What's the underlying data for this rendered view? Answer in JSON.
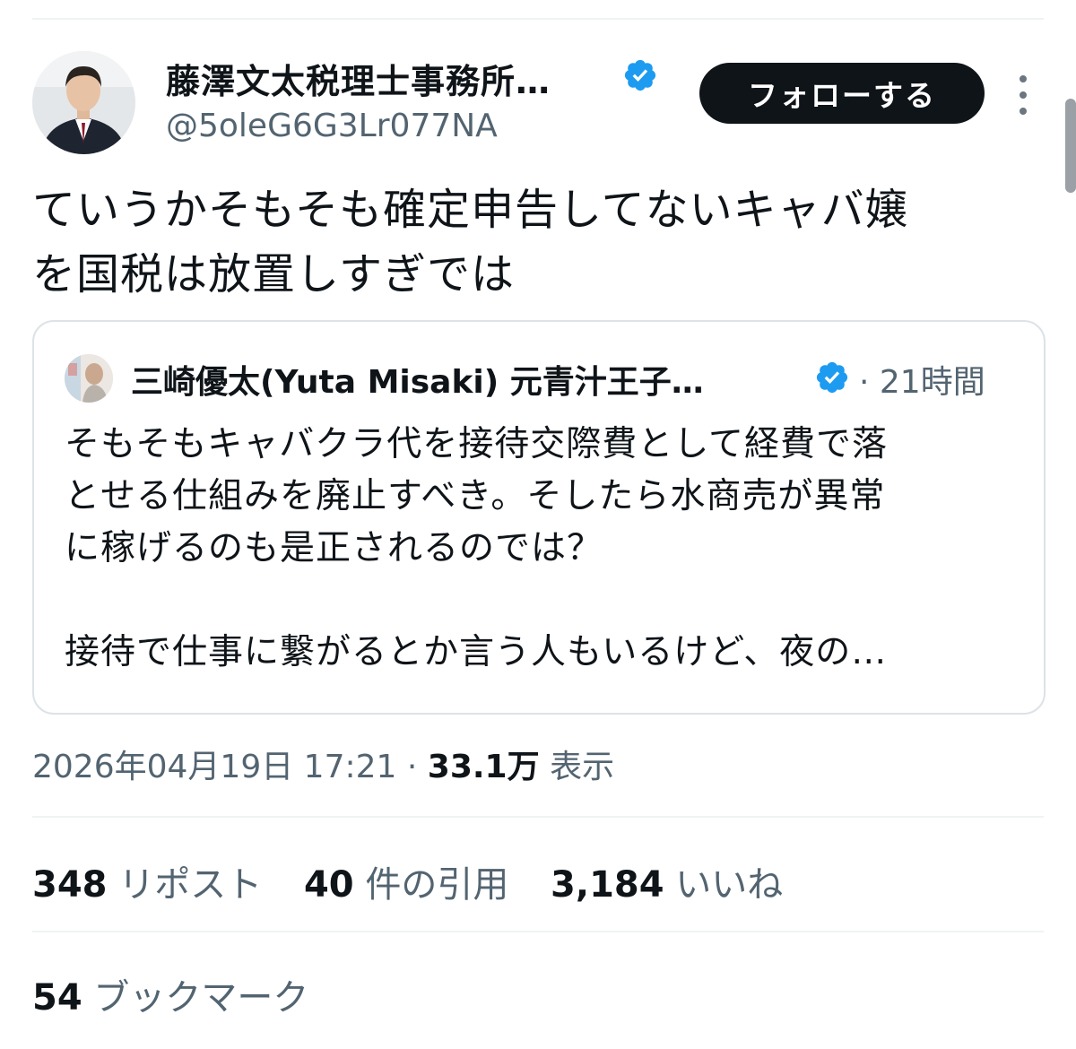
{
  "tweet": {
    "author": {
      "name": "藤澤文太税理士事務所…",
      "handle": "@5oleG6G3Lr077NA",
      "verified": true
    },
    "follow_label": "フォローする",
    "text_lines": [
      "ていうかそもそも確定申告してないキャバ嬢",
      "を国税は放置しすぎでは"
    ],
    "quote": {
      "author": "三崎優太(Yuta Misaki) 元青汁王子…",
      "verified": true,
      "time": "· 21時間",
      "lines": [
        "そもそもキャバクラ代を接待交際費として経費で落",
        "とせる仕組みを廃止すべき。そしたら水商売が異常",
        "に稼げるのも是正されるのでは？",
        "接待で仕事に繋がるとか言う人もいるけど、夜の…"
      ]
    },
    "meta": {
      "timestamp": "2026年04月19日 17:21",
      "separator": " · ",
      "views_count": "33.1万",
      "views_label": "表示"
    },
    "stats": {
      "reposts_count": "348",
      "reposts_label": "リポスト",
      "quotes_count": "40",
      "quotes_label": "件の引用",
      "likes_count": "3,184",
      "likes_label": "いいね",
      "bookmarks_count": "54",
      "bookmarks_label": "ブックマーク"
    }
  },
  "colors": {
    "text_primary": "#0f1419",
    "text_secondary": "#536471",
    "verified_blue": "#1d9bf0",
    "button_bg": "#0f1419",
    "border": "#dce3e7"
  },
  "icons": {
    "verified": "verified-badge-icon",
    "more": "more-vertical-icon"
  }
}
